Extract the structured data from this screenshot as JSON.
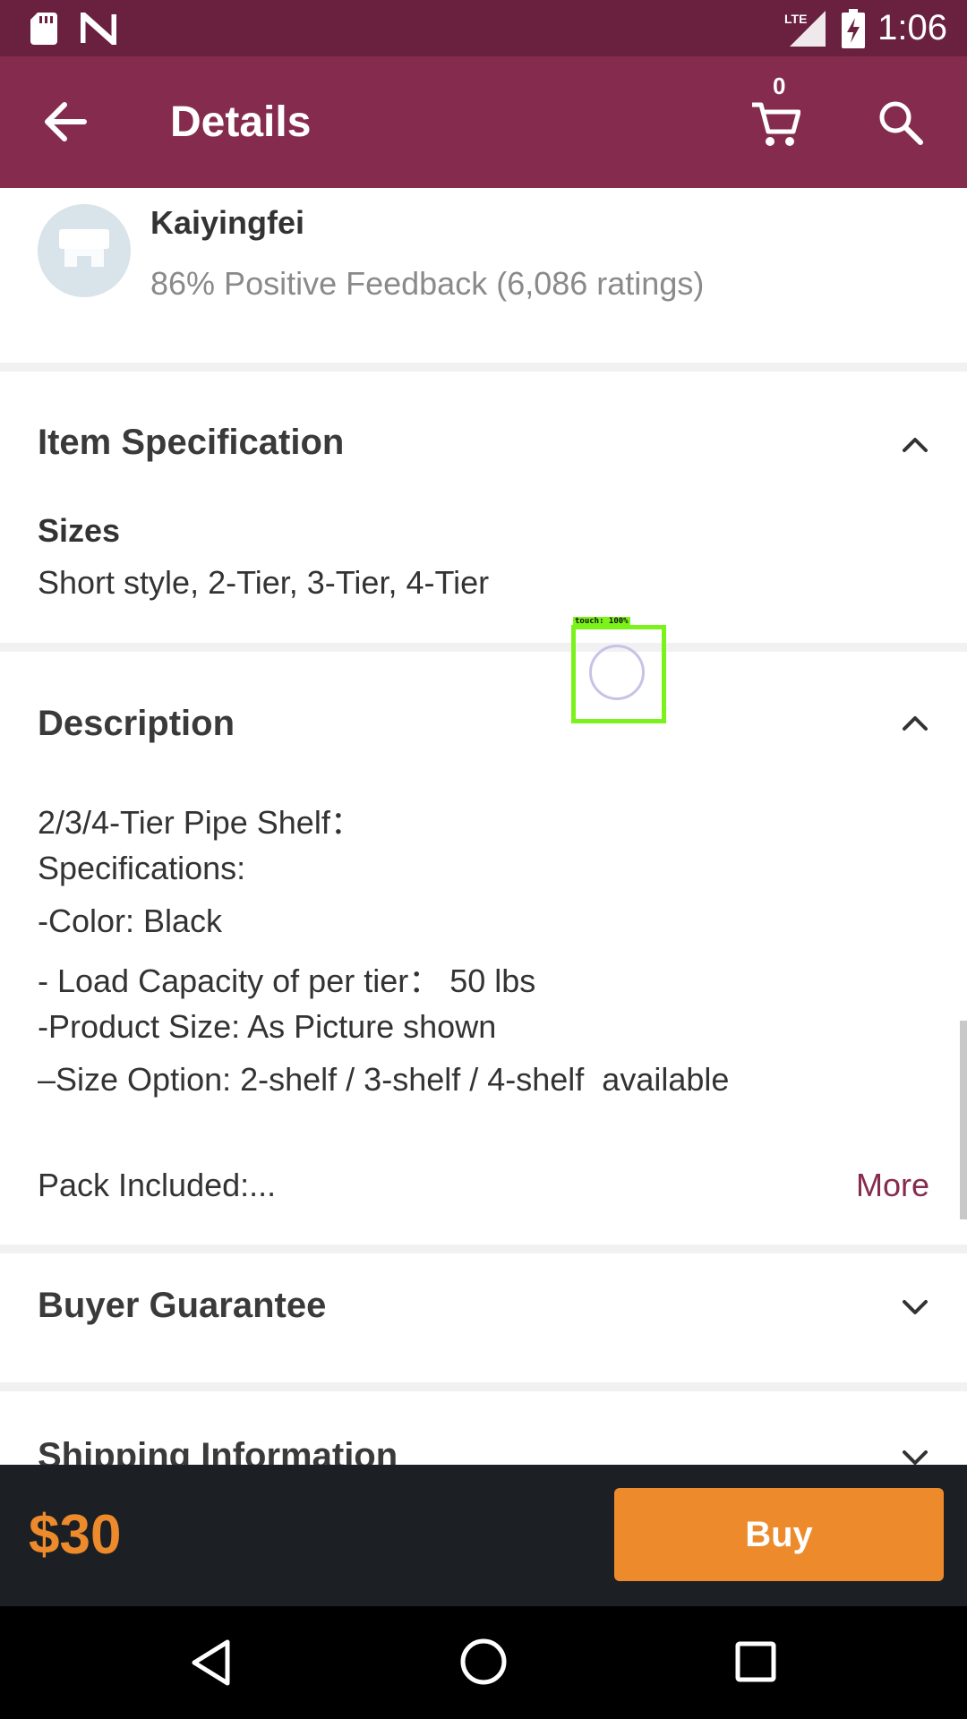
{
  "status_bar": {
    "time": "1:06",
    "network": "LTE",
    "icons": [
      "sd-card-icon",
      "n-logo-icon",
      "lte-signal-icon",
      "battery-charging-icon"
    ]
  },
  "app_bar": {
    "title": "Details",
    "cart_count": "0",
    "icons": [
      "back-arrow-icon",
      "cart-icon",
      "search-icon"
    ]
  },
  "seller": {
    "name": "Kaiyingfei",
    "feedback": "86% Positive Feedback (6,086 ratings)"
  },
  "item_specification": {
    "title": "Item Specification",
    "sizes_label": "Sizes",
    "sizes_value": "Short style, 2-Tier, 3-Tier, 4-Tier"
  },
  "description": {
    "title": "Description",
    "lines": [
      "2/3/4-Tier Pipe Shelf：",
      "Specifications:",
      "-Color: Black",
      "- Load Capacity of per tier： 50 lbs",
      "-Product Size: As Picture shown",
      "–Size Option: 2-shelf / 3-shelf / 4-shelf  available"
    ],
    "pack_included": "Pack Included:...",
    "more_label": "More"
  },
  "buyer_guarantee": {
    "title": "Buyer Guarantee"
  },
  "shipping_information": {
    "title": "Shipping Information"
  },
  "bottom_bar": {
    "price": "$30",
    "buy_label": "Buy"
  },
  "touch_overlay": {
    "label": "touch: 100%"
  },
  "colors": {
    "status_bar": "#6a2140",
    "app_bar": "#852c4e",
    "accent_orange": "#ec8a2c",
    "bottom_bar": "#1c2024"
  }
}
